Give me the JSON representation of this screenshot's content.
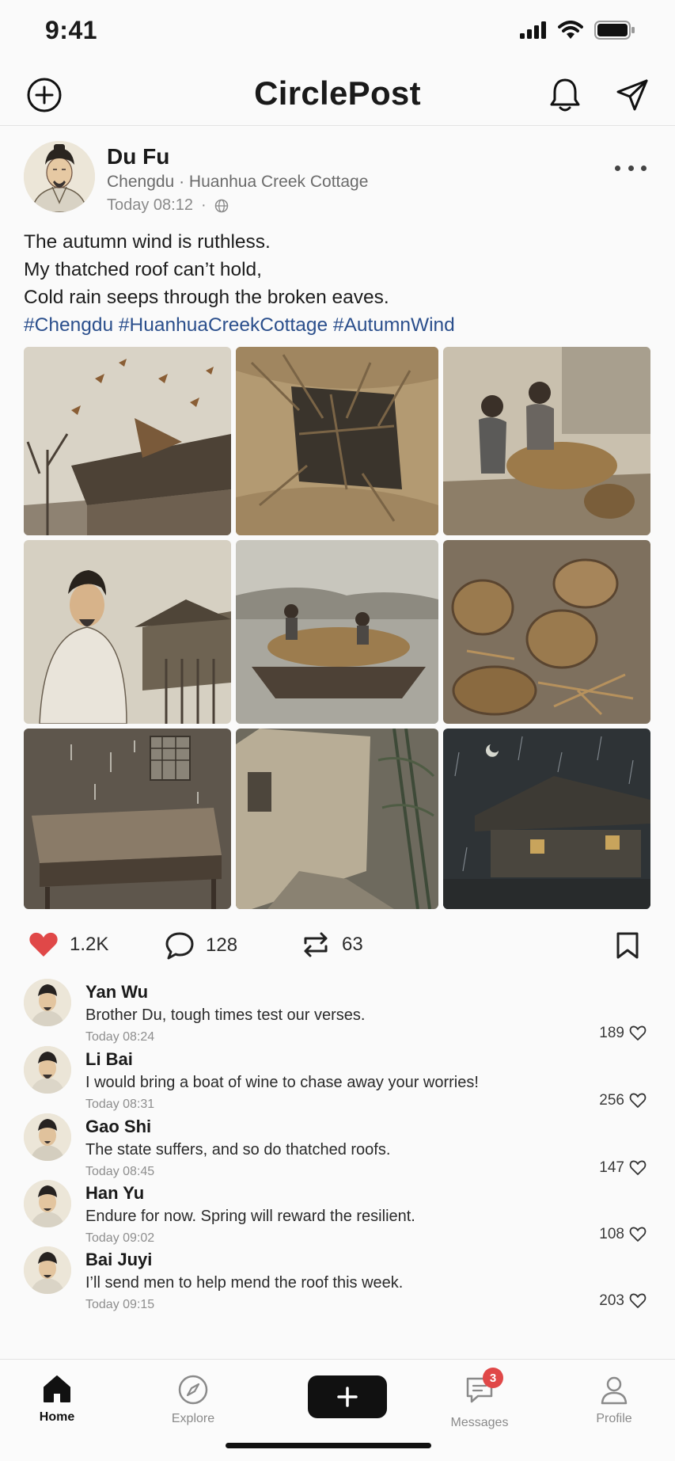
{
  "status_bar": {
    "time": "9:41"
  },
  "app": {
    "title": "CirclePost"
  },
  "post": {
    "author": "Du Fu",
    "location_city": "Chengdu",
    "location_place": "Huanhua Creek Cottage",
    "timestamp": "Today 08:12",
    "lines": [
      "The autumn wind is ruthless.",
      "My thatched roof can’t hold,",
      "Cold rain seeps through the broken eaves."
    ],
    "hashtags": "#Chengdu #HuanhuaCreekCottage #AutumnWind",
    "images": [
      "wind-leaves-roof",
      "torn-thatch-closeup",
      "children-carrying-straw",
      "poet-in-wind",
      "boat-with-straw",
      "broken-baskets",
      "leaking-bed",
      "crumbling-wall",
      "cottage-night-rain"
    ],
    "stats": {
      "likes": "1.2K",
      "comments": "128",
      "reposts": "63"
    }
  },
  "comments": [
    {
      "name": "Yan Wu",
      "text": "Brother Du, tough times test our verses.",
      "time": "Today 08:24",
      "likes": "189"
    },
    {
      "name": "Li Bai",
      "text": "I would bring a boat of wine to chase away your worries!",
      "time": "Today 08:31",
      "likes": "256"
    },
    {
      "name": "Gao Shi",
      "text": "The state suffers, and so do thatched roofs.",
      "time": "Today 08:45",
      "likes": "147"
    },
    {
      "name": "Han Yu",
      "text": "Endure for now. Spring will reward the resilient.",
      "time": "Today 09:02",
      "likes": "108"
    },
    {
      "name": "Bai Juyi",
      "text": "I’ll send men to help mend the roof this week.",
      "time": "Today 09:15",
      "likes": "203"
    }
  ],
  "tabs": {
    "home": "Home",
    "explore": "Explore",
    "messages": "Messages",
    "messages_badge": "3",
    "profile": "Profile"
  },
  "colors": {
    "like_red": "#e04848",
    "hashtag_blue": "#2b4f8c",
    "badge_red": "#e04848"
  }
}
